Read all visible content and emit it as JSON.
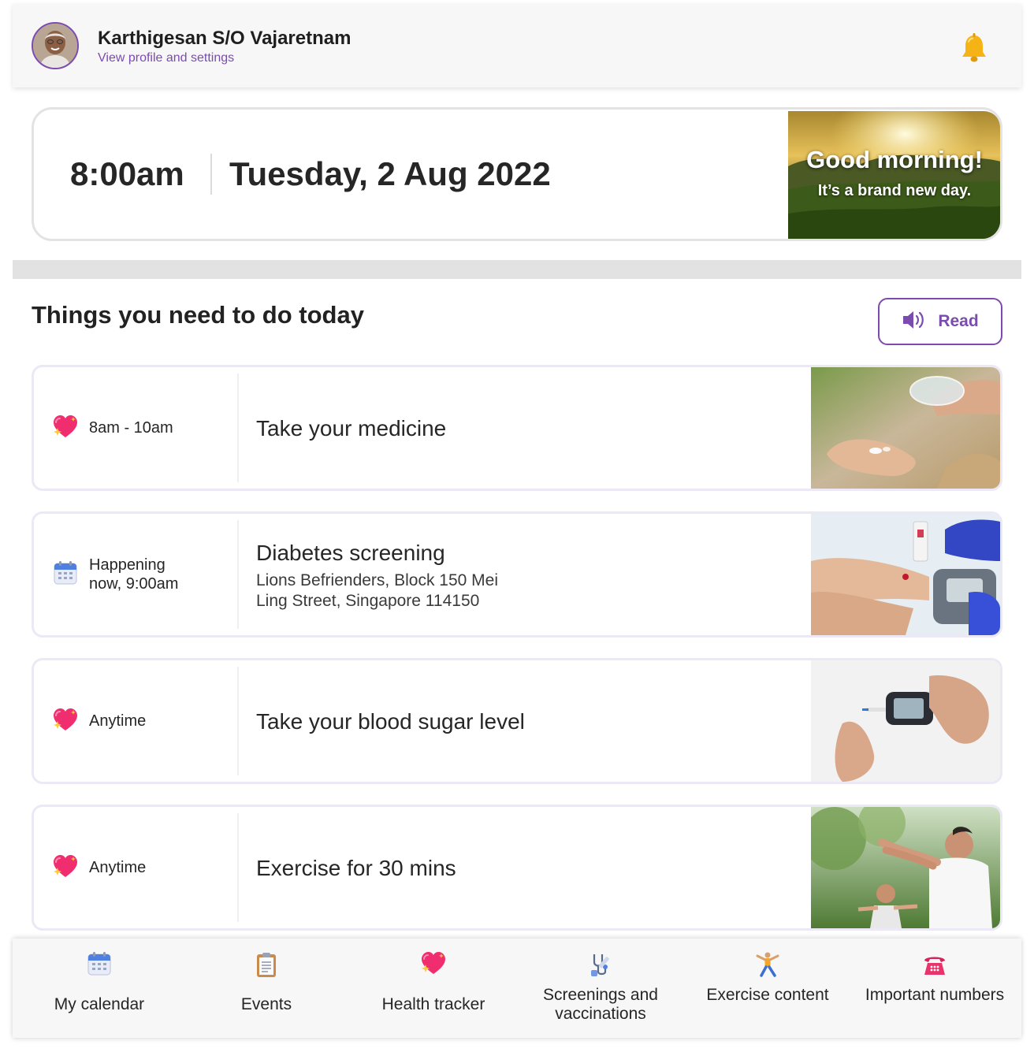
{
  "header": {
    "user_name": "Karthigesan S/O Vajaretnam",
    "profile_link": "View profile and settings",
    "avatar_icon": "elderly-man-avatar",
    "notification_icon": "bell-icon"
  },
  "clock": {
    "time": "8:00am",
    "date": "Tuesday, 2 Aug 2022",
    "greeting_title": "Good morning!",
    "greeting_subtitle": "It’s a brand new day."
  },
  "todo": {
    "title": "Things you need to do today",
    "read_label": "Read",
    "read_icon": "speaker-icon",
    "tasks": [
      {
        "when": "8am - 10am",
        "icon": "sparkling-heart-icon",
        "title": "Take your medicine",
        "location": "",
        "image": "medicine-pills-photo"
      },
      {
        "when": "Happening now, 9:00am",
        "icon": "calendar-icon",
        "title": "Diabetes screening",
        "location": "Lions Befrienders, Block 150 Mei Ling Street, Singapore 114150",
        "image": "blood-glucose-test-photo"
      },
      {
        "when": "Anytime",
        "icon": "sparkling-heart-icon",
        "title": "Take your blood sugar level",
        "location": "",
        "image": "glucose-meter-photo"
      },
      {
        "when": "Anytime",
        "icon": "sparkling-heart-icon",
        "title": "Exercise for 30 mins",
        "location": "",
        "image": "elderly-exercise-photo"
      }
    ]
  },
  "nav": {
    "items": [
      {
        "label": "My calendar",
        "icon": "calendar-icon"
      },
      {
        "label": "Events",
        "icon": "clipboard-icon"
      },
      {
        "label": "Health tracker",
        "icon": "sparkling-heart-icon"
      },
      {
        "label": "Screenings and vaccinations",
        "icon": "stethoscope-syringe-icon"
      },
      {
        "label": "Exercise content",
        "icon": "person-exercising-icon"
      },
      {
        "label": "Important numbers",
        "icon": "telephone-icon"
      }
    ]
  },
  "colors": {
    "accent": "#7b4bb0",
    "bell": "#f5b316",
    "heart": "#f02d6e"
  }
}
